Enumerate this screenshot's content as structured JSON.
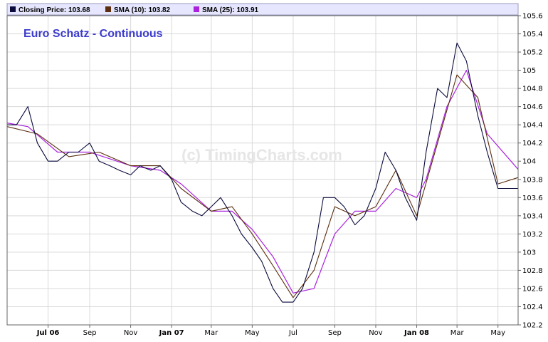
{
  "colors": {
    "price": "#0a0a3c",
    "sma10": "#5a2e0e",
    "sma25": "#aa22dd",
    "title": "#3b3bcc",
    "grid": "#d9d9d9",
    "legend_bg": "#e6e6ff"
  },
  "chart_data": {
    "type": "line",
    "title": "Euro Schatz - Continuous",
    "watermark": "(c) TimingCharts.com",
    "legend": [
      {
        "label": "Closing Price: 103.68",
        "series": "price"
      },
      {
        "label": "SMA (10): 103.82",
        "series": "sma10"
      },
      {
        "label": "SMA (25): 103.91",
        "series": "sma25"
      }
    ],
    "legend_position": "top",
    "ylim": [
      102.2,
      105.6
    ],
    "ytick_labels": [
      "102.2",
      "102.4",
      "102.6",
      "102.8",
      "103",
      "103.2",
      "103.4",
      "103.6",
      "103.8",
      "104",
      "104.2",
      "104.4",
      "104.6",
      "104.8",
      "105",
      "105.2",
      "105.4",
      "105.6"
    ],
    "ytick_values": [
      102.2,
      102.4,
      102.6,
      102.8,
      103.0,
      103.2,
      103.4,
      103.6,
      103.8,
      104.0,
      104.2,
      104.4,
      104.6,
      104.8,
      105.0,
      105.2,
      105.4,
      105.6
    ],
    "x_range": [
      "2006-05-01",
      "2008-05-31"
    ],
    "xtick_labels": [
      {
        "label": "Jul 06",
        "date": "2006-07-01",
        "bold": true
      },
      {
        "label": "Sep",
        "date": "2006-09-01",
        "bold": false
      },
      {
        "label": "Nov",
        "date": "2006-11-01",
        "bold": false
      },
      {
        "label": "Jan 07",
        "date": "2007-01-01",
        "bold": true
      },
      {
        "label": "Mar",
        "date": "2007-03-01",
        "bold": false
      },
      {
        "label": "May",
        "date": "2007-05-01",
        "bold": false
      },
      {
        "label": "Jul",
        "date": "2007-07-01",
        "bold": false
      },
      {
        "label": "Sep",
        "date": "2007-09-01",
        "bold": false
      },
      {
        "label": "Nov",
        "date": "2007-11-01",
        "bold": false
      },
      {
        "label": "Jan 08",
        "date": "2008-01-01",
        "bold": true
      },
      {
        "label": "Mar",
        "date": "2008-03-01",
        "bold": false
      },
      {
        "label": "May",
        "date": "2008-05-01",
        "bold": false
      }
    ],
    "grid": true,
    "series": [
      {
        "key": "price",
        "x": [
          "2006-05-01",
          "2006-05-15",
          "2006-06-01",
          "2006-06-15",
          "2006-07-01",
          "2006-07-15",
          "2006-08-01",
          "2006-08-15",
          "2006-09-01",
          "2006-09-15",
          "2006-10-01",
          "2006-10-15",
          "2006-11-01",
          "2006-11-15",
          "2006-12-01",
          "2006-12-15",
          "2007-01-01",
          "2007-01-15",
          "2007-02-01",
          "2007-02-15",
          "2007-03-01",
          "2007-03-15",
          "2007-04-01",
          "2007-04-15",
          "2007-05-01",
          "2007-05-15",
          "2007-06-01",
          "2007-06-15",
          "2007-07-01",
          "2007-07-15",
          "2007-08-01",
          "2007-08-15",
          "2007-09-01",
          "2007-09-15",
          "2007-10-01",
          "2007-10-15",
          "2007-11-01",
          "2007-11-15",
          "2007-12-01",
          "2007-12-15",
          "2008-01-01",
          "2008-01-15",
          "2008-02-01",
          "2008-02-15",
          "2008-03-01",
          "2008-03-15",
          "2008-04-01",
          "2008-04-15",
          "2008-05-01",
          "2008-05-31"
        ],
        "values": [
          104.4,
          104.4,
          104.6,
          104.2,
          104.0,
          104.0,
          104.1,
          104.1,
          104.2,
          104.0,
          103.95,
          103.9,
          103.85,
          103.95,
          103.9,
          103.95,
          103.8,
          103.55,
          103.45,
          103.4,
          103.5,
          103.6,
          103.4,
          103.2,
          103.05,
          102.9,
          102.6,
          102.45,
          102.45,
          102.6,
          103.0,
          103.6,
          103.6,
          103.5,
          103.3,
          103.4,
          103.7,
          104.1,
          103.9,
          103.6,
          103.35,
          104.1,
          104.8,
          104.7,
          105.3,
          105.1,
          104.5,
          104.1,
          103.7,
          103.7
        ]
      },
      {
        "key": "sma10",
        "x": [
          "2006-05-01",
          "2006-06-15",
          "2006-08-01",
          "2006-09-15",
          "2006-11-01",
          "2006-12-15",
          "2007-01-15",
          "2007-03-01",
          "2007-04-01",
          "2007-05-01",
          "2007-06-01",
          "2007-07-01",
          "2007-08-01",
          "2007-09-01",
          "2007-10-01",
          "2007-11-01",
          "2007-12-01",
          "2008-01-01",
          "2008-02-01",
          "2008-03-01",
          "2008-04-01",
          "2008-05-01",
          "2008-05-31"
        ],
        "values": [
          104.38,
          104.3,
          104.05,
          104.1,
          103.95,
          103.95,
          103.7,
          103.45,
          103.5,
          103.2,
          102.85,
          102.5,
          102.8,
          103.5,
          103.4,
          103.5,
          103.9,
          103.4,
          104.2,
          104.95,
          104.7,
          103.75,
          103.82
        ]
      },
      {
        "key": "sma25",
        "x": [
          "2006-05-01",
          "2006-06-01",
          "2006-07-15",
          "2006-09-01",
          "2006-11-01",
          "2006-12-15",
          "2007-01-15",
          "2007-03-01",
          "2007-04-01",
          "2007-05-01",
          "2007-06-01",
          "2007-07-01",
          "2007-08-01",
          "2007-09-01",
          "2007-10-01",
          "2007-11-01",
          "2007-12-01",
          "2008-01-01",
          "2008-01-15",
          "2008-02-15",
          "2008-03-15",
          "2008-04-15",
          "2008-05-31"
        ],
        "values": [
          104.42,
          104.38,
          104.1,
          104.1,
          103.95,
          103.9,
          103.75,
          103.45,
          103.45,
          103.25,
          102.95,
          102.55,
          102.6,
          103.2,
          103.45,
          103.45,
          103.7,
          103.6,
          103.8,
          104.6,
          105.0,
          104.3,
          103.91
        ]
      }
    ]
  }
}
